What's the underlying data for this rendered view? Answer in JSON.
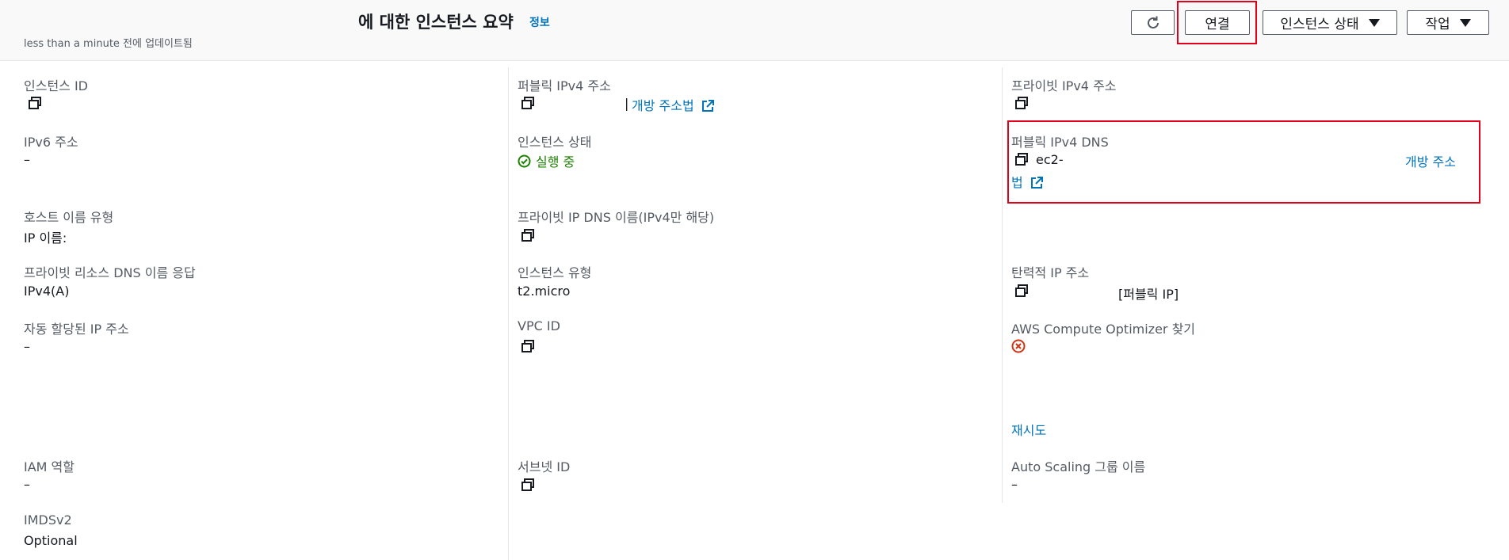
{
  "header": {
    "title": "에 대한 인스턴스 요약",
    "info_link": "정보",
    "updated": "less than a minute 전에 업데이트됨",
    "buttons": {
      "refresh_icon": "refresh-icon",
      "connect": "연결",
      "instance_state": "인스턴스 상태",
      "actions": "작업"
    }
  },
  "fields": {
    "instance_id": {
      "label": "인스턴스 ID"
    },
    "public_ipv4": {
      "label": "퍼블릭 IPv4 주소",
      "separator": "|",
      "open_link": "개방 주소법"
    },
    "private_ipv4": {
      "label": "프라이빗 IPv4 주소"
    },
    "ipv6": {
      "label": "IPv6 주소",
      "value": "–"
    },
    "instance_state": {
      "label": "인스턴스 상태",
      "value": "실행 중"
    },
    "public_dns": {
      "label": "퍼블릭 IPv4 DNS",
      "value": "ec2-",
      "open_link_line1": "개방 주소",
      "open_link_line2": "법"
    },
    "hostname_type": {
      "label": "호스트 이름 유형",
      "value": "IP 이름:"
    },
    "private_ip_dns": {
      "label": "프라이빗 IP DNS 이름(IPv4만 해당)"
    },
    "private_resource_dns": {
      "label": "프라이빗 리소스 DNS 이름 응답",
      "value": "IPv4(A)"
    },
    "instance_type": {
      "label": "인스턴스 유형",
      "value": "t2.micro"
    },
    "elastic_ip": {
      "label": "탄력적 IP 주소",
      "value": "[퍼블릭 IP]"
    },
    "auto_assigned_ip": {
      "label": "자동 할당된 IP 주소",
      "value": "–"
    },
    "vpc_id": {
      "label": "VPC ID"
    },
    "compute_optimizer": {
      "label": "AWS Compute Optimizer 찾기",
      "retry": "재시도"
    },
    "iam_role": {
      "label": "IAM 역할",
      "value": "–"
    },
    "subnet_id": {
      "label": "서브넷 ID"
    },
    "auto_scaling": {
      "label": "Auto Scaling 그룹 이름",
      "value": "–"
    },
    "imdsv2": {
      "label": "IMDSv2",
      "value": "Optional"
    }
  },
  "colors": {
    "link": "#0073bb",
    "success": "#1d8102",
    "error": "#d13212",
    "highlight": "#e3001b"
  }
}
